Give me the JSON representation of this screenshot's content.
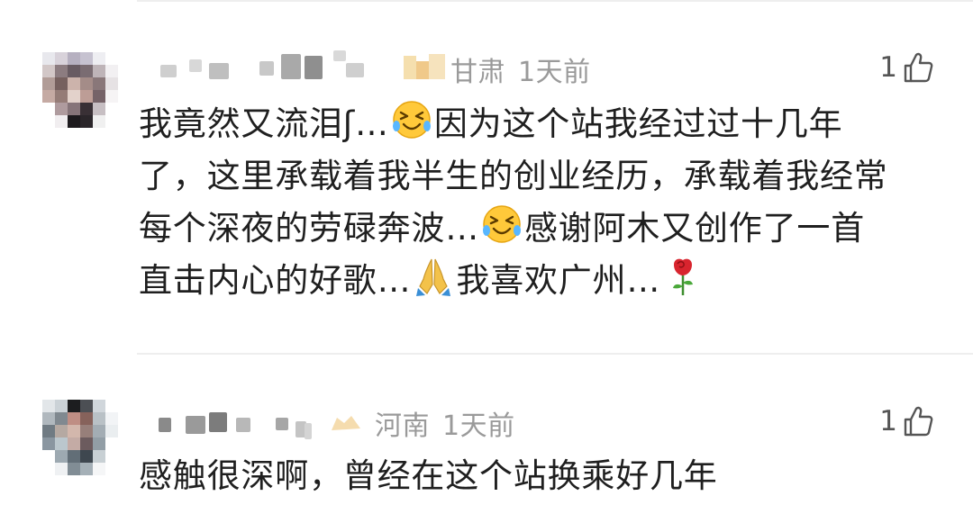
{
  "comments": [
    {
      "location": "甘肃",
      "time": "1天前",
      "likes": "1",
      "lines": [
        [
          "我竟然又流泪ʃ…",
          {
            "emoji": "grinning-squint-tears-icon"
          },
          "因为这个站我经过过十几年"
        ],
        [
          "了，这里承载着我半生的创业经历，承载着我经常"
        ],
        [
          "每个深夜的劳碌奔波…",
          {
            "emoji": "grinning-squint-tears-icon"
          },
          "感谢阿木又创作了一首"
        ],
        [
          "直击内心的好歌…",
          {
            "emoji": "folded-hands-icon"
          },
          "我喜欢广州…",
          {
            "emoji": "rose-icon"
          }
        ]
      ],
      "line1_a": "我竟然又流泪ʃ…",
      "line1_b": "因为这个站我经过过十几年",
      "line2": "了，这里承载着我半生的创业经历，承载着我经常",
      "line3_a": "每个深夜的劳碌奔波…",
      "line3_b": "感谢阿木又创作了一首",
      "line4_a": "直击内心的好歌…",
      "line4_b": "我喜欢广州…"
    },
    {
      "location": "河南",
      "time": "1天前",
      "likes": "1",
      "line1": "感触很深啊，曾经在这个站换乘好几年"
    }
  ],
  "icons": {
    "like": "thumbs-up-outline-icon",
    "avatar": "blurred-avatar",
    "username": "blurred-username"
  },
  "colors": {
    "meta": "#9a9a9a",
    "body_text": "#1f1f1f",
    "divider": "#eeeeee",
    "badge": "#f3d9a6"
  }
}
